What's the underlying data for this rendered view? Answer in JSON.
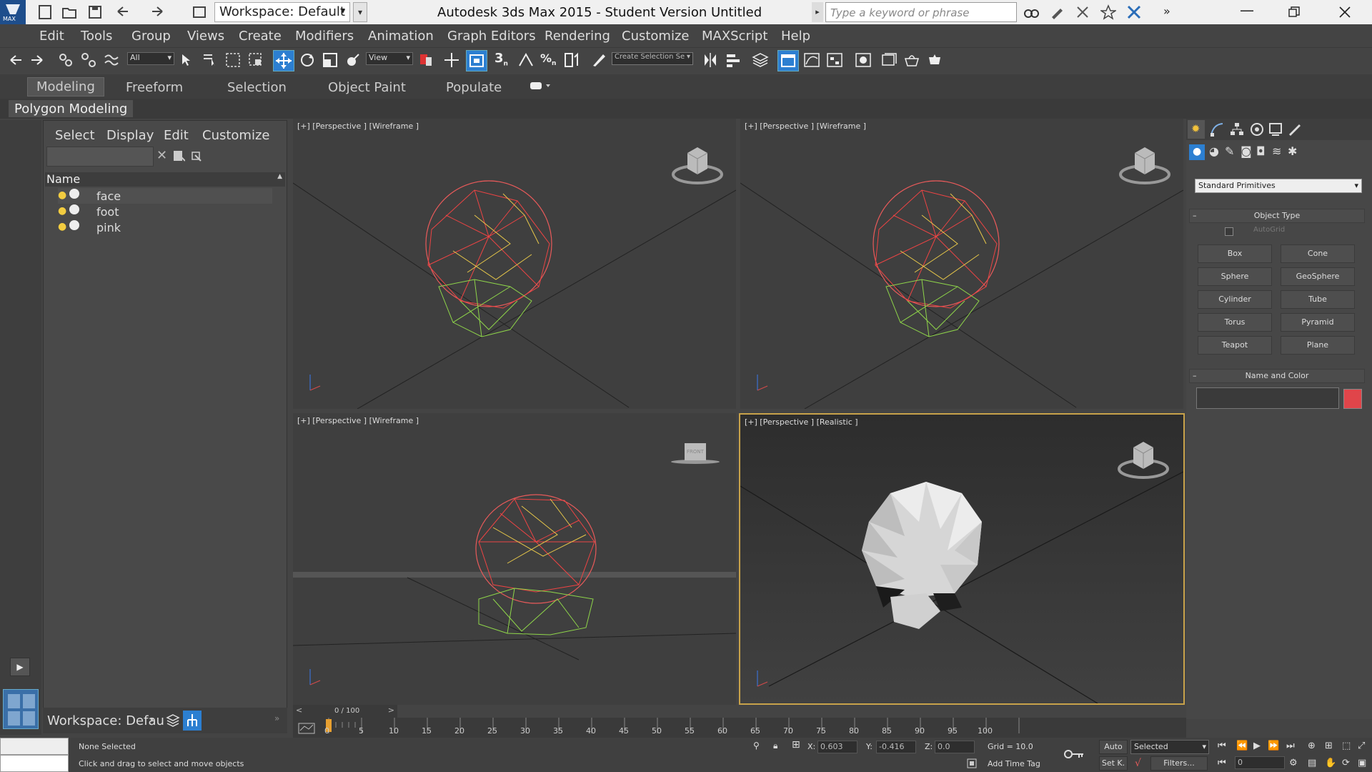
{
  "titlebar": {
    "app_title": "Autodesk 3ds Max  2015   - Student Version     Untitled",
    "workspace_value": "Workspace: Default",
    "search_placeholder": "Type a keyword or phrase",
    "logo_text": "MAX"
  },
  "menu": [
    "Edit",
    "Tools",
    "Group",
    "Views",
    "Create",
    "Modifiers",
    "Animation",
    "Graph Editors",
    "Rendering",
    "Customize",
    "MAXScript",
    "Help"
  ],
  "toolbar": {
    "selection_filter": "All",
    "ref_coord": "View",
    "named_selection": "Create Selection Se"
  },
  "ribbon": {
    "tabs": [
      "Modeling",
      "Freeform",
      "Selection",
      "Object Paint",
      "Populate"
    ],
    "active_tab": "Modeling",
    "panel_label": "Polygon Modeling"
  },
  "explorer": {
    "menu": [
      "Select",
      "Display",
      "Edit",
      "Customize"
    ],
    "column_header": "Name",
    "objects": [
      "face",
      "foot",
      "pink"
    ],
    "workspace_label": "Workspace: Defau"
  },
  "viewports": {
    "top_left": "[+] [Perspective ] [Wireframe ]",
    "top_right": "[+] [Perspective ] [Wireframe ]",
    "bottom_left": "[+] [Perspective ] [Wireframe ]",
    "bottom_right": "[+] [Perspective ] [Realistic ]",
    "viewcube_front": "FRONT"
  },
  "command_panel": {
    "category": "Standard Primitives",
    "object_type_title": "Object Type",
    "autogrid": "AutoGrid",
    "buttons": [
      "Box",
      "Cone",
      "Sphere",
      "GeoSphere",
      "Cylinder",
      "Tube",
      "Torus",
      "Pyramid",
      "Teapot",
      "Plane"
    ],
    "name_color_title": "Name and Color",
    "swatch_color": "#e0454a"
  },
  "timeline": {
    "frame_label": "0 / 100",
    "ticks": [
      "0",
      "5",
      "10",
      "15",
      "20",
      "25",
      "30",
      "35",
      "40",
      "45",
      "50",
      "55",
      "60",
      "65",
      "70",
      "75",
      "80",
      "85",
      "90",
      "95",
      "100"
    ]
  },
  "status": {
    "selection": "None Selected",
    "prompt": "Click and drag to select and move objects",
    "x_label": "X:",
    "x_value": "0.603",
    "y_label": "Y:",
    "y_value": "-0.416",
    "z_label": "Z:",
    "z_value": "0.0",
    "grid": "Grid = 10.0",
    "add_time_tag": "Add Time Tag",
    "auto": "Auto",
    "setk": "Set K.",
    "key_filter": "Selected",
    "filters": "Filters...",
    "frame_value": "0"
  }
}
